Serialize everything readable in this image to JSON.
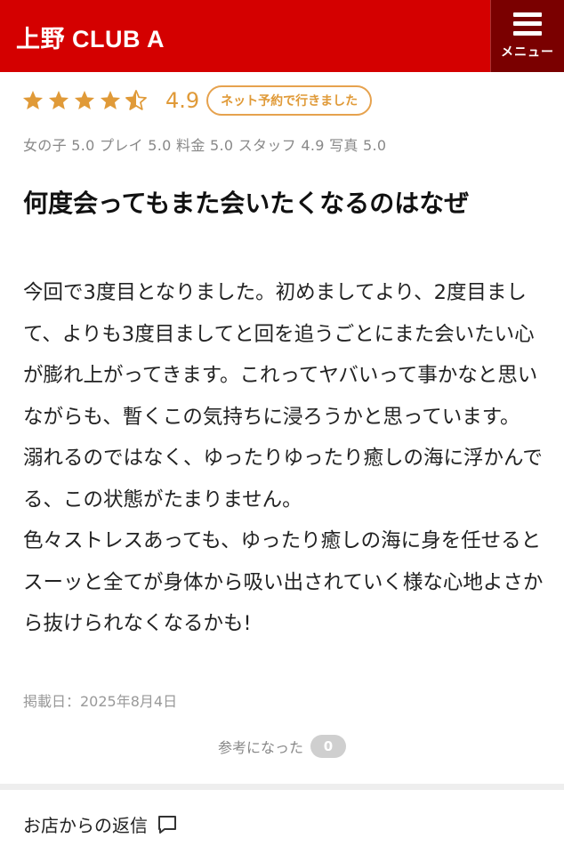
{
  "header": {
    "brand": "上野 CLUB A",
    "menu_label": "メニュー",
    "bg_color": "#d40000",
    "menu_bg_color": "#7a0000"
  },
  "review": {
    "stars": [
      1,
      1,
      1,
      1,
      0.5
    ],
    "rating": "4.9",
    "badge": "ネット予約で行きました",
    "accent_color": "#e09a38",
    "sub_scores": "女の子 5.0 プレイ 5.0 料金 5.0 スタッフ 4.9 写真 5.0",
    "title": "何度会ってもまた会いたくなるのはなぜ",
    "body": "今回で3度目となりました。初めましてより、2度目まして、よりも3度目ましてと回を追うごとにまた会いたい心が膨れ上がってきます。これってヤバいって事かなと思いながらも、暫くこの気持ちに浸ろうかと思っています。\n溺れるのではなく、ゆったりゆったり癒しの海に浮かんでる、この状態がたまりません。\n色々ストレスあっても、ゆったり癒しの海に身を任せるとスーッと全てが身体から吸い出されていく様な心地よさから抜けられなくなるかも!",
    "post_date": "掲載日：2025年8月4日",
    "helpful_label": "参考になった",
    "helpful_count": "0"
  },
  "shop_reply": {
    "label": "お店からの返信",
    "icon": "comment-icon"
  }
}
